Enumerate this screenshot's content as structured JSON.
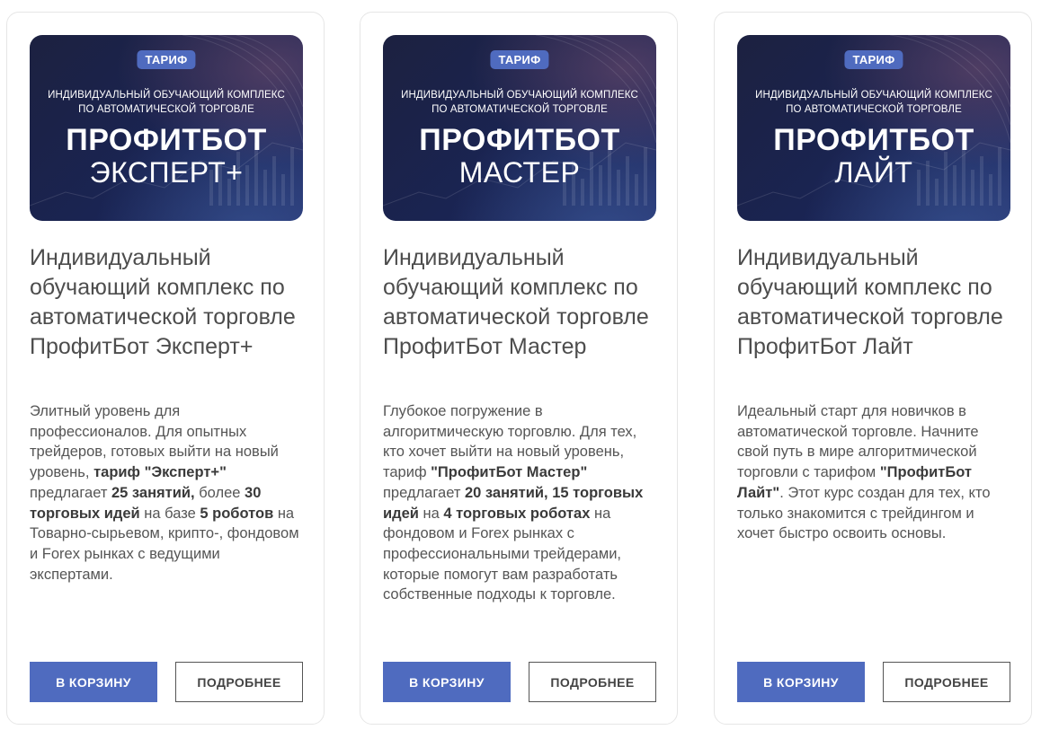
{
  "cards": [
    {
      "badge": "ТАРИФ",
      "banner_sub_1": "ИНДИВИДУАЛЬНЫЙ ОБУЧАЮЩИЙ КОМПЛЕКС",
      "banner_sub_2": "ПО АВТОМАТИЧЕСКОЙ ТОРГОВЛЕ",
      "banner_title": "ПРОФИТБОТ",
      "banner_name": "ЭКСПЕРТ+",
      "title": "Индивидуальный обучающий комплекс по автоматической торговле ПрофитБот Эксперт+",
      "desc": [
        {
          "t": "Элитный уровень для профессионалов. Для опытных трейдеров, готовых выйти на новый уровень, "
        },
        {
          "t": "тариф \"Эксперт+\"",
          "b": true
        },
        {
          "t": " предлагает "
        },
        {
          "t": "25 занятий,",
          "b": true
        },
        {
          "t": " более "
        },
        {
          "t": "30 торговых идей",
          "b": true
        },
        {
          "t": " на базе "
        },
        {
          "t": "5 роботов",
          "b": true
        },
        {
          "t": " на Товарно-сырьевом, крипто-, фондовом и Forex рынках с ведущими экспертами."
        }
      ],
      "cart_label": "В КОРЗИНУ",
      "more_label": "ПОДРОБНЕЕ"
    },
    {
      "badge": "ТАРИФ",
      "banner_sub_1": "ИНДИВИДУАЛЬНЫЙ ОБУЧАЮЩИЙ КОМПЛЕКС",
      "banner_sub_2": "ПО АВТОМАТИЧЕСКОЙ ТОРГОВЛЕ",
      "banner_title": "ПРОФИТБОТ",
      "banner_name": "МАСТЕР",
      "title": "Индивидуальный обучающий комплекс по автоматической торговле ПрофитБот Мастер",
      "desc": [
        {
          "t": "Глубокое погружение в алгоритмическую торговлю. Для тех, кто хочет выйти на новый уровень, тариф "
        },
        {
          "t": "\"ПрофитБот Мастер\"",
          "b": true
        },
        {
          "t": " предлагает "
        },
        {
          "t": "20 занятий, 15 торговых идей",
          "b": true
        },
        {
          "t": " на "
        },
        {
          "t": "4 торговых роботах",
          "b": true
        },
        {
          "t": " на фондовом и Forex рынках  с профессиональными трейдерами, которые помогут вам разработать собственные подходы к торговле."
        }
      ],
      "cart_label": "В КОРЗИНУ",
      "more_label": "ПОДРОБНЕЕ"
    },
    {
      "badge": "ТАРИФ",
      "banner_sub_1": "ИНДИВИДУАЛЬНЫЙ ОБУЧАЮЩИЙ КОМПЛЕКС",
      "banner_sub_2": "ПО АВТОМАТИЧЕСКОЙ ТОРГОВЛЕ",
      "banner_title": "ПРОФИТБОТ",
      "banner_name": "ЛАЙТ",
      "title": "Индивидуальный обучающий комплекс по автоматической торговле ПрофитБот Лайт",
      "desc": [
        {
          "t": "Идеальный старт для новичков в автоматической торговле. Начните свой путь в мире алгоритмической торговли с тарифом "
        },
        {
          "t": "\"ПрофитБот Лайт\"",
          "b": true
        },
        {
          "t": ". Этот курс создан для тех, кто только знакомится с трейдингом и хочет быстро освоить основы."
        }
      ],
      "cart_label": "В КОРЗИНУ",
      "more_label": "ПОДРОБНЕЕ"
    }
  ],
  "colors": {
    "accent": "#4f6bbf",
    "banner_dark": "#1a2453"
  }
}
